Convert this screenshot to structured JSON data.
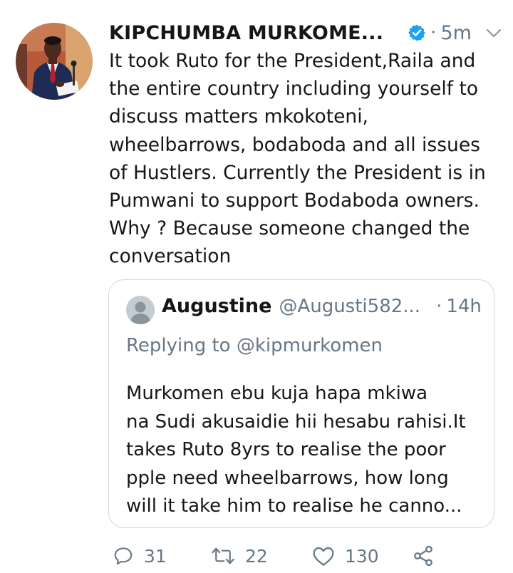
{
  "tweet": {
    "author_name": "KIPCHUMBA MURKOME...",
    "separator": "·",
    "time": "5m",
    "text": "It took Ruto for the President,Raila and\nthe entire country including yourself to\ndiscuss matters mkokoteni,\nwheelbarrows, bodaboda and all issues\nof Hustlers. Currently the President is in\nPumwani to support Bodaboda owners.\nWhy ? Because someone changed the\nconversation"
  },
  "quoted": {
    "name": "Augustine",
    "handle": "@Augusti582...",
    "separator": "·",
    "time": "14h",
    "replying_to": "Replying to @kipmurkomen",
    "text": "Murkomen ebu kuja hapa mkiwa\nna Sudi akusaidie hii hesabu rahisi.It\ntakes Ruto 8yrs to realise the poor\npple need wheelbarrows, how long\nwill it take him to realise he canno..."
  },
  "actions": {
    "replies": "31",
    "retweets": "22",
    "likes": "130"
  },
  "colors": {
    "verified_blue": "#1da1f2",
    "secondary_text": "#657786",
    "border": "#ccd6dd"
  },
  "icons": {
    "verified": "verified-badge-icon",
    "caret": "chevron-down-icon",
    "reply": "reply-icon",
    "retweet": "retweet-icon",
    "like": "heart-icon",
    "share": "share-icon"
  }
}
